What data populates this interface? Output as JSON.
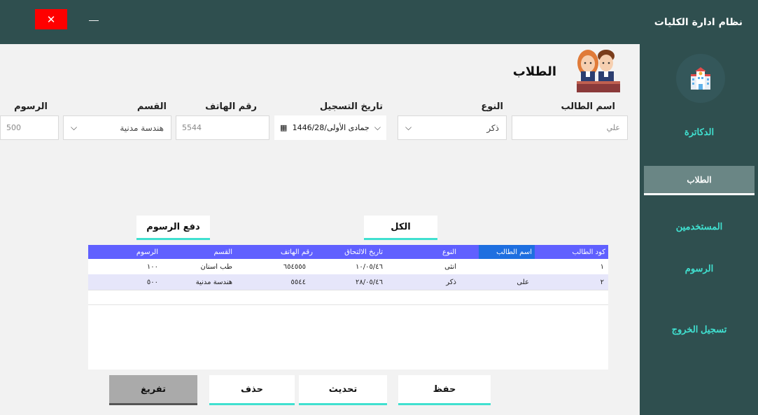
{
  "window": {
    "title": "نظام ادارة الكليات",
    "close_glyph": "✕",
    "minimize_glyph": "—"
  },
  "sidebar": {
    "logo_icon": "school-building-icon",
    "items": [
      {
        "label": "الدكاترة",
        "active": false
      },
      {
        "label": "الطلاب",
        "active": true
      },
      {
        "label": "المستخدمين",
        "active": false
      },
      {
        "label": "الرسوم",
        "active": false
      },
      {
        "label": "تسجيل الخروج",
        "active": false
      }
    ]
  },
  "header": {
    "title": "الطلاب",
    "image_icon": "students-avatar-icon"
  },
  "form": {
    "student_name": {
      "label": "اسم الطالب",
      "value": "علي"
    },
    "gender": {
      "label": "النوع",
      "value": "ذكر"
    },
    "registration_date": {
      "label": "تاريخ التسجيل",
      "value": "جمادى الأولى/1446/28"
    },
    "phone": {
      "label": "رقم الهاتف",
      "value": "5544"
    },
    "department": {
      "label": "القسم",
      "value": "هندسة مدنية"
    },
    "fees": {
      "label": "الرسوم",
      "value": "500"
    }
  },
  "filters": {
    "all_label": "الكل",
    "pay_fees_label": "دفع الرسوم"
  },
  "grid": {
    "columns": [
      "كود الطالب",
      "اسم الطالب",
      "النوع",
      "تاريخ الالتحاق",
      "رقم الهاتف",
      "القسم",
      "الرسوم"
    ],
    "rows": [
      [
        "١",
        "",
        "انثى",
        "١٠/٠٥/٤٦",
        "٦٥٤٥٥٥",
        "طب اسنان",
        "١٠٠"
      ],
      [
        "٢",
        "على",
        "ذكر",
        "٢٨/٠٥/٤٦",
        "٥٥٤٤",
        "هندسة مدنية",
        "٥٠٠"
      ]
    ]
  },
  "actions": {
    "save": "حفظ",
    "update": "تحديث",
    "delete": "حذف",
    "clear": "تفريغ"
  },
  "colors": {
    "titlebar": "#2f4f4f",
    "accent": "#40e0d0",
    "grid_header": "#6060ff",
    "close": "#ff0000"
  }
}
